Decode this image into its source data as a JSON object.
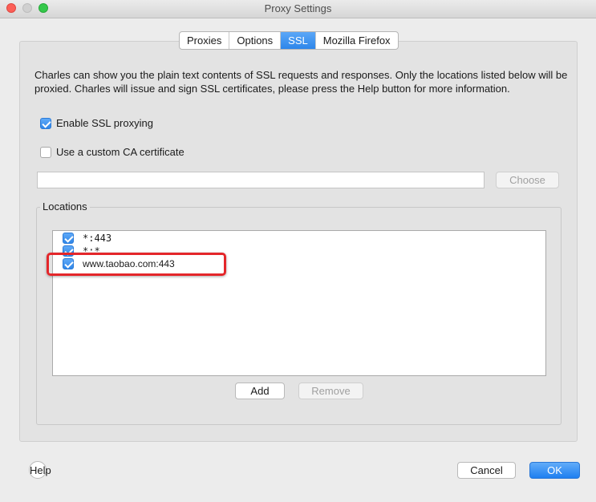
{
  "window": {
    "title": "Proxy Settings"
  },
  "tabs": [
    {
      "label": "Proxies",
      "active": false
    },
    {
      "label": "Options",
      "active": false
    },
    {
      "label": "SSL",
      "active": true
    },
    {
      "label": "Mozilla Firefox",
      "active": false
    }
  ],
  "ssl": {
    "description": "Charles can show you the plain text contents of SSL requests and responses. Only the locations listed below will be proxied. Charles will issue and sign SSL certificates, please press the Help button for more information.",
    "enable_ssl_label": "Enable SSL proxying",
    "enable_ssl_checked": true,
    "custom_ca_label": "Use a custom CA certificate",
    "custom_ca_checked": false,
    "ca_path_value": "",
    "choose_label": "Choose",
    "locations_title": "Locations",
    "locations": [
      {
        "label": "*:443",
        "checked": true
      },
      {
        "label": "*:*",
        "checked": true
      },
      {
        "label": "www.taobao.com:443",
        "checked": true
      }
    ],
    "add_label": "Add",
    "remove_label": "Remove"
  },
  "footer": {
    "help_label": "Help",
    "cancel_label": "Cancel",
    "ok_label": "OK"
  },
  "colors": {
    "accent": "#2d86ea",
    "highlight_box": "#e4262a"
  }
}
